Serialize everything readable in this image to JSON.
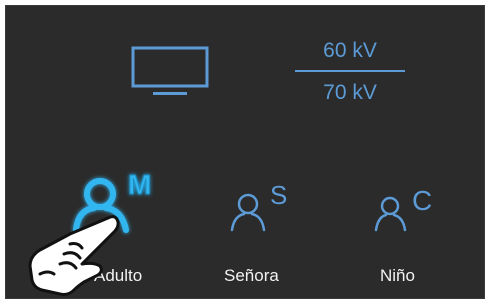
{
  "kv": {
    "top": "60 kV",
    "bottom": "70 kV"
  },
  "patients": [
    {
      "label": "Adulto",
      "letter": "M",
      "icon": "person-icon",
      "selected": true
    },
    {
      "label": "Señora",
      "letter": "S",
      "icon": "person-icon",
      "selected": false
    },
    {
      "label": "Niño",
      "letter": "C",
      "icon": "person-icon",
      "selected": false
    }
  ],
  "colors": {
    "background": "#2b2b2b",
    "accent": "#5c9bd6",
    "selected": "#33b6f0",
    "text": "#f2f2f2"
  },
  "icons": {
    "monitor": "monitor-icon",
    "hand": "pointing-hand-icon"
  }
}
